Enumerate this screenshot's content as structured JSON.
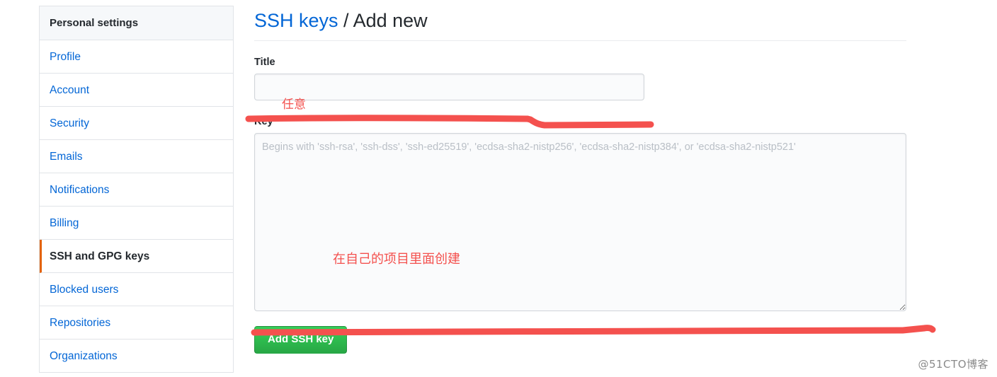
{
  "sidebar": {
    "header": "Personal settings",
    "items": [
      {
        "label": "Profile",
        "active": false
      },
      {
        "label": "Account",
        "active": false
      },
      {
        "label": "Security",
        "active": false
      },
      {
        "label": "Emails",
        "active": false
      },
      {
        "label": "Notifications",
        "active": false
      },
      {
        "label": "Billing",
        "active": false
      },
      {
        "label": "SSH and GPG keys",
        "active": true
      },
      {
        "label": "Blocked users",
        "active": false
      },
      {
        "label": "Repositories",
        "active": false
      },
      {
        "label": "Organizations",
        "active": false
      }
    ],
    "active_indicator_color": "#e36209"
  },
  "main": {
    "title_link": "SSH keys",
    "title_separator": " / ",
    "title_current": "Add new",
    "title_link_color": "#0366d6",
    "title_label": "Title",
    "title_value": "",
    "title_placeholder": "",
    "key_label": "Key",
    "key_value": "",
    "key_placeholder": "Begins with 'ssh-rsa', 'ssh-dss', 'ssh-ed25519', 'ecdsa-sha2-nistp256', 'ecdsa-sha2-nistp384', or 'ecdsa-sha2-nistp521'",
    "submit_label": "Add SSH key",
    "submit_color": "#28a745"
  },
  "annotations": {
    "color": "#f4514e",
    "title_note": "任意",
    "key_note": "在自己的项目里面创建"
  },
  "watermark": "@51CTO博客"
}
